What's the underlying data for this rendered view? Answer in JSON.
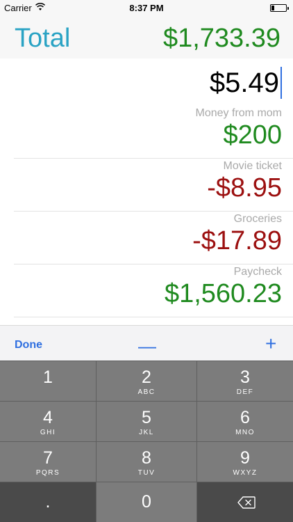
{
  "status": {
    "carrier": "Carrier",
    "time": "8:37 PM"
  },
  "header": {
    "title": "Total",
    "total": "$1,733.39"
  },
  "entry": {
    "value": "$5.49"
  },
  "transactions": [
    {
      "description": "Money from mom",
      "amount": "$200",
      "sign": "positive"
    },
    {
      "description": "Movie ticket",
      "amount": "-$8.95",
      "sign": "negative"
    },
    {
      "description": "Groceries",
      "amount": "-$17.89",
      "sign": "negative"
    },
    {
      "description": "Paycheck",
      "amount": "$1,560.23",
      "sign": "positive"
    }
  ],
  "accessory": {
    "done": "Done",
    "minus": "—",
    "plus": "+"
  },
  "keypad": {
    "k1": {
      "num": "1",
      "letters": ""
    },
    "k2": {
      "num": "2",
      "letters": "ABC"
    },
    "k3": {
      "num": "3",
      "letters": "DEF"
    },
    "k4": {
      "num": "4",
      "letters": "GHI"
    },
    "k5": {
      "num": "5",
      "letters": "JKL"
    },
    "k6": {
      "num": "6",
      "letters": "MNO"
    },
    "k7": {
      "num": "7",
      "letters": "PQRS"
    },
    "k8": {
      "num": "8",
      "letters": "TUV"
    },
    "k9": {
      "num": "9",
      "letters": "WXYZ"
    },
    "dot": ".",
    "k0": "0",
    "delete_icon": "backspace-icon"
  },
  "colors": {
    "accent": "#2aa3c4",
    "positive": "#1f8a1f",
    "negative": "#9c1010",
    "link": "#2f6fe0"
  }
}
